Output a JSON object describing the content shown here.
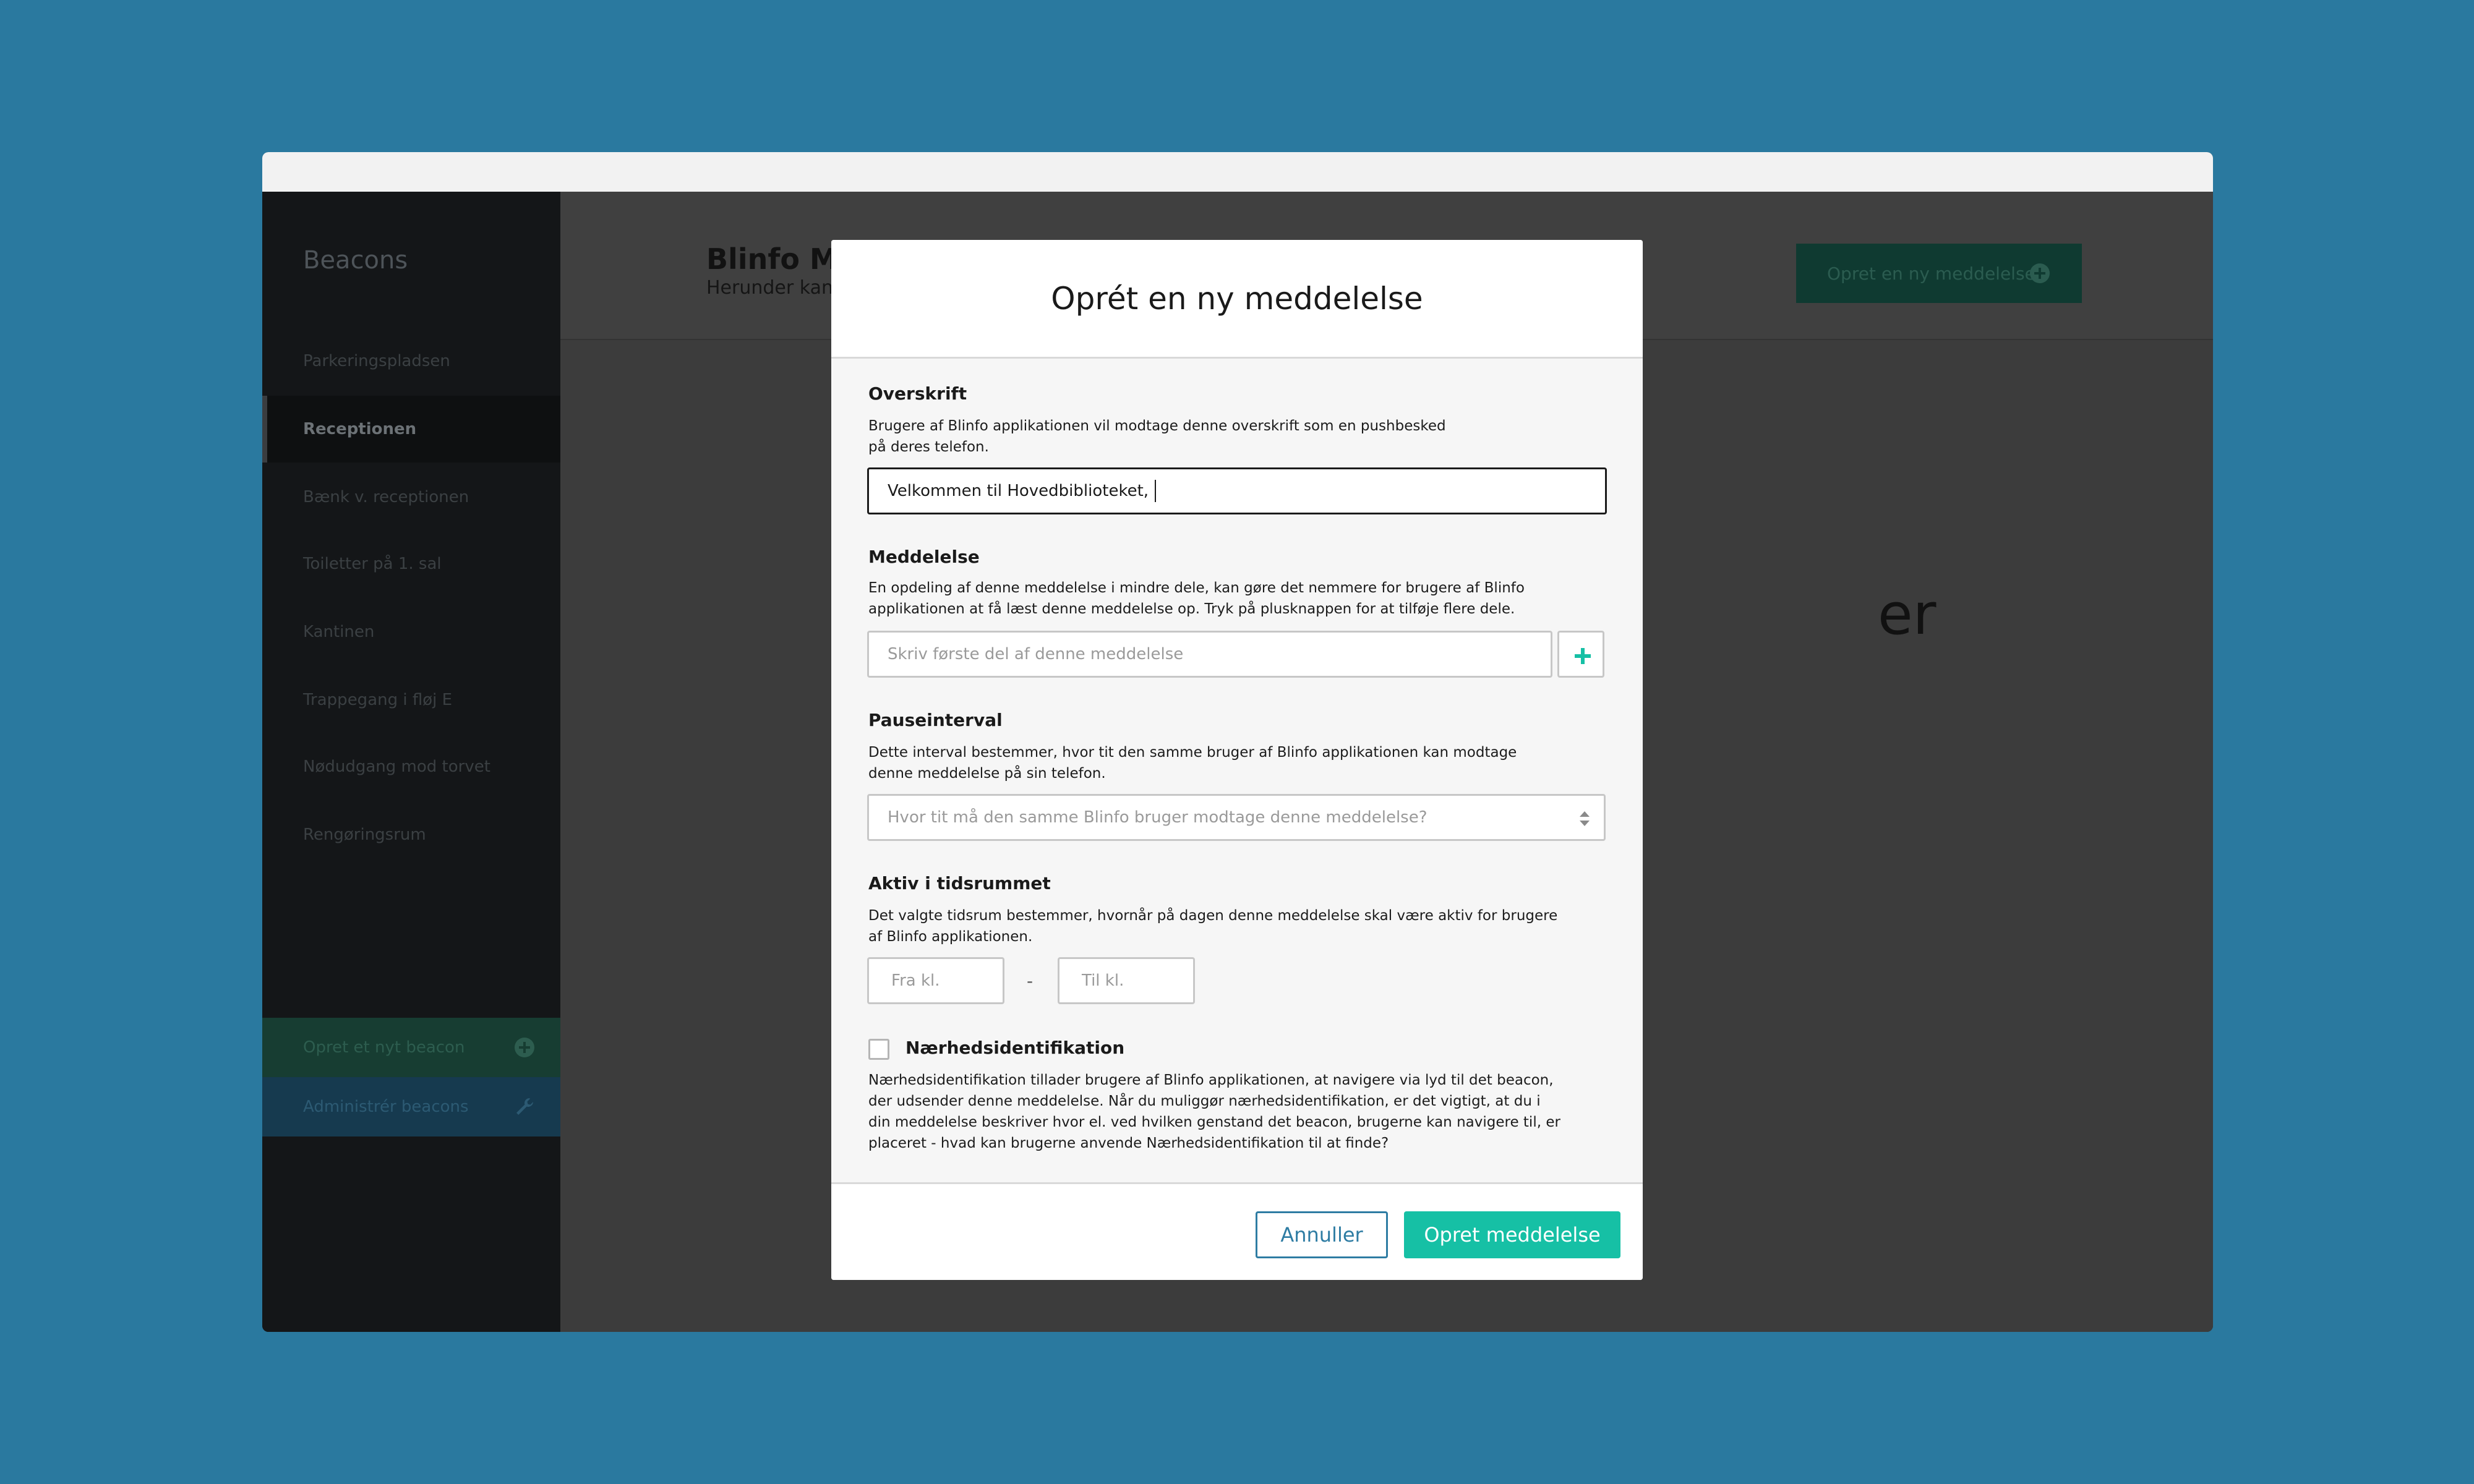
{
  "colors": {
    "background": "#2a799f",
    "accent_green": "#16c0a5",
    "accent_blue": "#2e7ca3"
  },
  "sidebar": {
    "title": "Beacons",
    "items": [
      {
        "label": "Parkeringspladsen"
      },
      {
        "label": "Receptionen",
        "active": true
      },
      {
        "label": "Bænk v. receptionen"
      },
      {
        "label": "Toiletter på 1. sal"
      },
      {
        "label": "Kantinen"
      },
      {
        "label": "Trappegang i fløj E"
      },
      {
        "label": "Nødudgang mod torvet"
      },
      {
        "label": "Rengøringsrum"
      }
    ],
    "create_beacon": {
      "label": "Opret et nyt beacon",
      "icon": "plus-circle-icon"
    },
    "manage_beacons": {
      "label": "Administrér beacons",
      "icon": "wrench-icon"
    }
  },
  "main": {
    "title_partial": "Blinfo Me",
    "subtitle_partial": "Herunder kan",
    "new_message_button": {
      "label": "Opret en ny meddelelse",
      "icon": "plus-circle-icon"
    },
    "background_text_fragment": "er"
  },
  "modal": {
    "title": "Oprét en ny meddelelse",
    "headline": {
      "label": "Overskrift",
      "description": "Brugere af Blinfo applikationen vil modtage denne overskrift som en pushbesked på deres telefon.",
      "value": "Velkommen til Hovedbiblioteket,"
    },
    "message": {
      "label": "Meddelelse",
      "description": "En opdeling af denne meddelelse i mindre dele, kan gøre det nemmere for brugere af Blinfo applikationen at få læst denne meddelelse op. Tryk på plusknappen for at tilføje flere dele.",
      "placeholder": "Skriv første del af denne meddelelse",
      "add_icon": "plus-icon"
    },
    "pause_interval": {
      "label": "Pauseinterval",
      "description": "Dette interval bestemmer, hvor tit den samme bruger af Blinfo applikationen kan modtage denne meddelelse på sin telefon.",
      "placeholder": "Hvor tit må den samme Blinfo bruger modtage denne meddelelse?"
    },
    "active_period": {
      "label": "Aktiv i tidsrummet",
      "description": "Det valgte tidsrum bestemmer, hvornår på dagen denne meddelelse skal være aktiv for brugere af Blinfo applikationen.",
      "from_placeholder": "Fra kl.",
      "separator": "-",
      "to_placeholder": "Til kl."
    },
    "proximity": {
      "label": "Nærhedsidentifikation",
      "checked": false,
      "description": "Nærhedsidentifikation tillader brugere af Blinfo applikationen, at navigere via lyd til det beacon, der udsender denne meddelelse. Når du muliggør nærhedsidentifikation, er det vigtigt, at du i din meddelelse beskriver hvor el. ved hvilken genstand det beacon, brugerne kan navigere til, er placeret - hvad kan brugerne anvende Nærhedsidentifikation til at finde?"
    },
    "cancel_label": "Annuller",
    "submit_label": "Opret meddelelse"
  }
}
